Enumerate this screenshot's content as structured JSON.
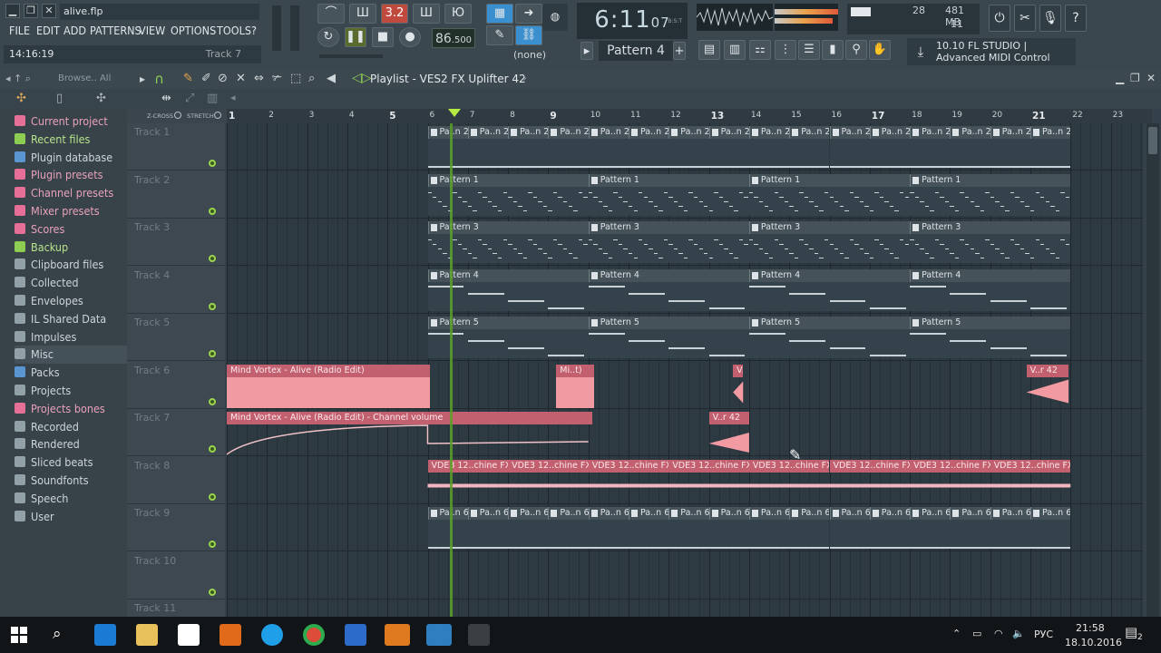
{
  "window": {
    "filename": "alive.flp",
    "min": "▁",
    "restore": "❐",
    "close": "✕"
  },
  "menu": [
    "FILE",
    "EDIT",
    "ADD",
    "PATTERNS",
    "VIEW",
    "OPTIONS",
    "TOOLS",
    "?"
  ],
  "hint": {
    "time": "14:16:19",
    "track": "Track 7"
  },
  "transport": {
    "pat_song": "3.2",
    "tempo": "86",
    "tempo_frac": ".500",
    "snap": "(none)"
  },
  "clock": {
    "main": "6:11",
    "sub": "07",
    "label": "B:S:T"
  },
  "pattern_selector": {
    "label": "Pattern 4",
    "add": "+"
  },
  "monitor": {
    "cpu": "28",
    "ram": "481 MB",
    "poly": "11"
  },
  "news": {
    "line1": "10.10  FL STUDIO |",
    "line2": "Advanced MIDI Control"
  },
  "browser": {
    "title": "Browse.. All",
    "items": [
      {
        "label": "Current project",
        "style": "pink"
      },
      {
        "label": "Recent files",
        "style": "green"
      },
      {
        "label": "Plugin database",
        "style": "blue"
      },
      {
        "label": "Plugin presets",
        "style": "pink"
      },
      {
        "label": "Channel presets",
        "style": "pink"
      },
      {
        "label": "Mixer presets",
        "style": "pink"
      },
      {
        "label": "Scores",
        "style": "pink"
      },
      {
        "label": "Backup",
        "style": "green"
      },
      {
        "label": "Clipboard files",
        "style": ""
      },
      {
        "label": "Collected",
        "style": ""
      },
      {
        "label": "Envelopes",
        "style": ""
      },
      {
        "label": "IL Shared Data",
        "style": ""
      },
      {
        "label": "Impulses",
        "style": ""
      },
      {
        "label": "Misc",
        "style": "sel"
      },
      {
        "label": "Packs",
        "style": "blue"
      },
      {
        "label": "Projects",
        "style": ""
      },
      {
        "label": "Projects bones",
        "style": "pink"
      },
      {
        "label": "Recorded",
        "style": ""
      },
      {
        "label": "Rendered",
        "style": ""
      },
      {
        "label": "Sliced beats",
        "style": ""
      },
      {
        "label": "Soundfonts",
        "style": ""
      },
      {
        "label": "Speech",
        "style": ""
      },
      {
        "label": "User",
        "style": ""
      }
    ]
  },
  "playlist": {
    "title": "Playlist - VES2 FX Uplifter 42",
    "zcross": "Z-CROSS",
    "stretch": "STRETCH",
    "ruler": [
      "1",
      "2",
      "3",
      "4",
      "5",
      "6",
      "7",
      "8",
      "9",
      "10",
      "11",
      "12",
      "13",
      "14",
      "15",
      "16",
      "17",
      "18",
      "19",
      "20",
      "21",
      "22",
      "23"
    ],
    "tracks": [
      "Track 1",
      "Track 2",
      "Track 3",
      "Track 4",
      "Track 5",
      "Track 6",
      "Track 7",
      "Track 8",
      "Track 9",
      "Track 10",
      "Track 11"
    ],
    "clip_labels": {
      "p2": "Pa..n 2",
      "p1": "Pattern 1",
      "p3": "Pattern 3",
      "p4": "Pattern 4",
      "p5": "Pattern 5",
      "p6": "Pa..n 6",
      "audio_long": "Mind Vortex - Alive (Radio Edit)",
      "audio_short": "Mi..t)",
      "v42": "V..r 42",
      "automation": "Mind Vortex - Alive (Radio Edit) - Channel volume",
      "vde": "VDE3 12..chine FX"
    }
  },
  "taskbar": {
    "lang": "РУС",
    "time": "21:58",
    "date": "18.10.2016",
    "notif": "2"
  }
}
